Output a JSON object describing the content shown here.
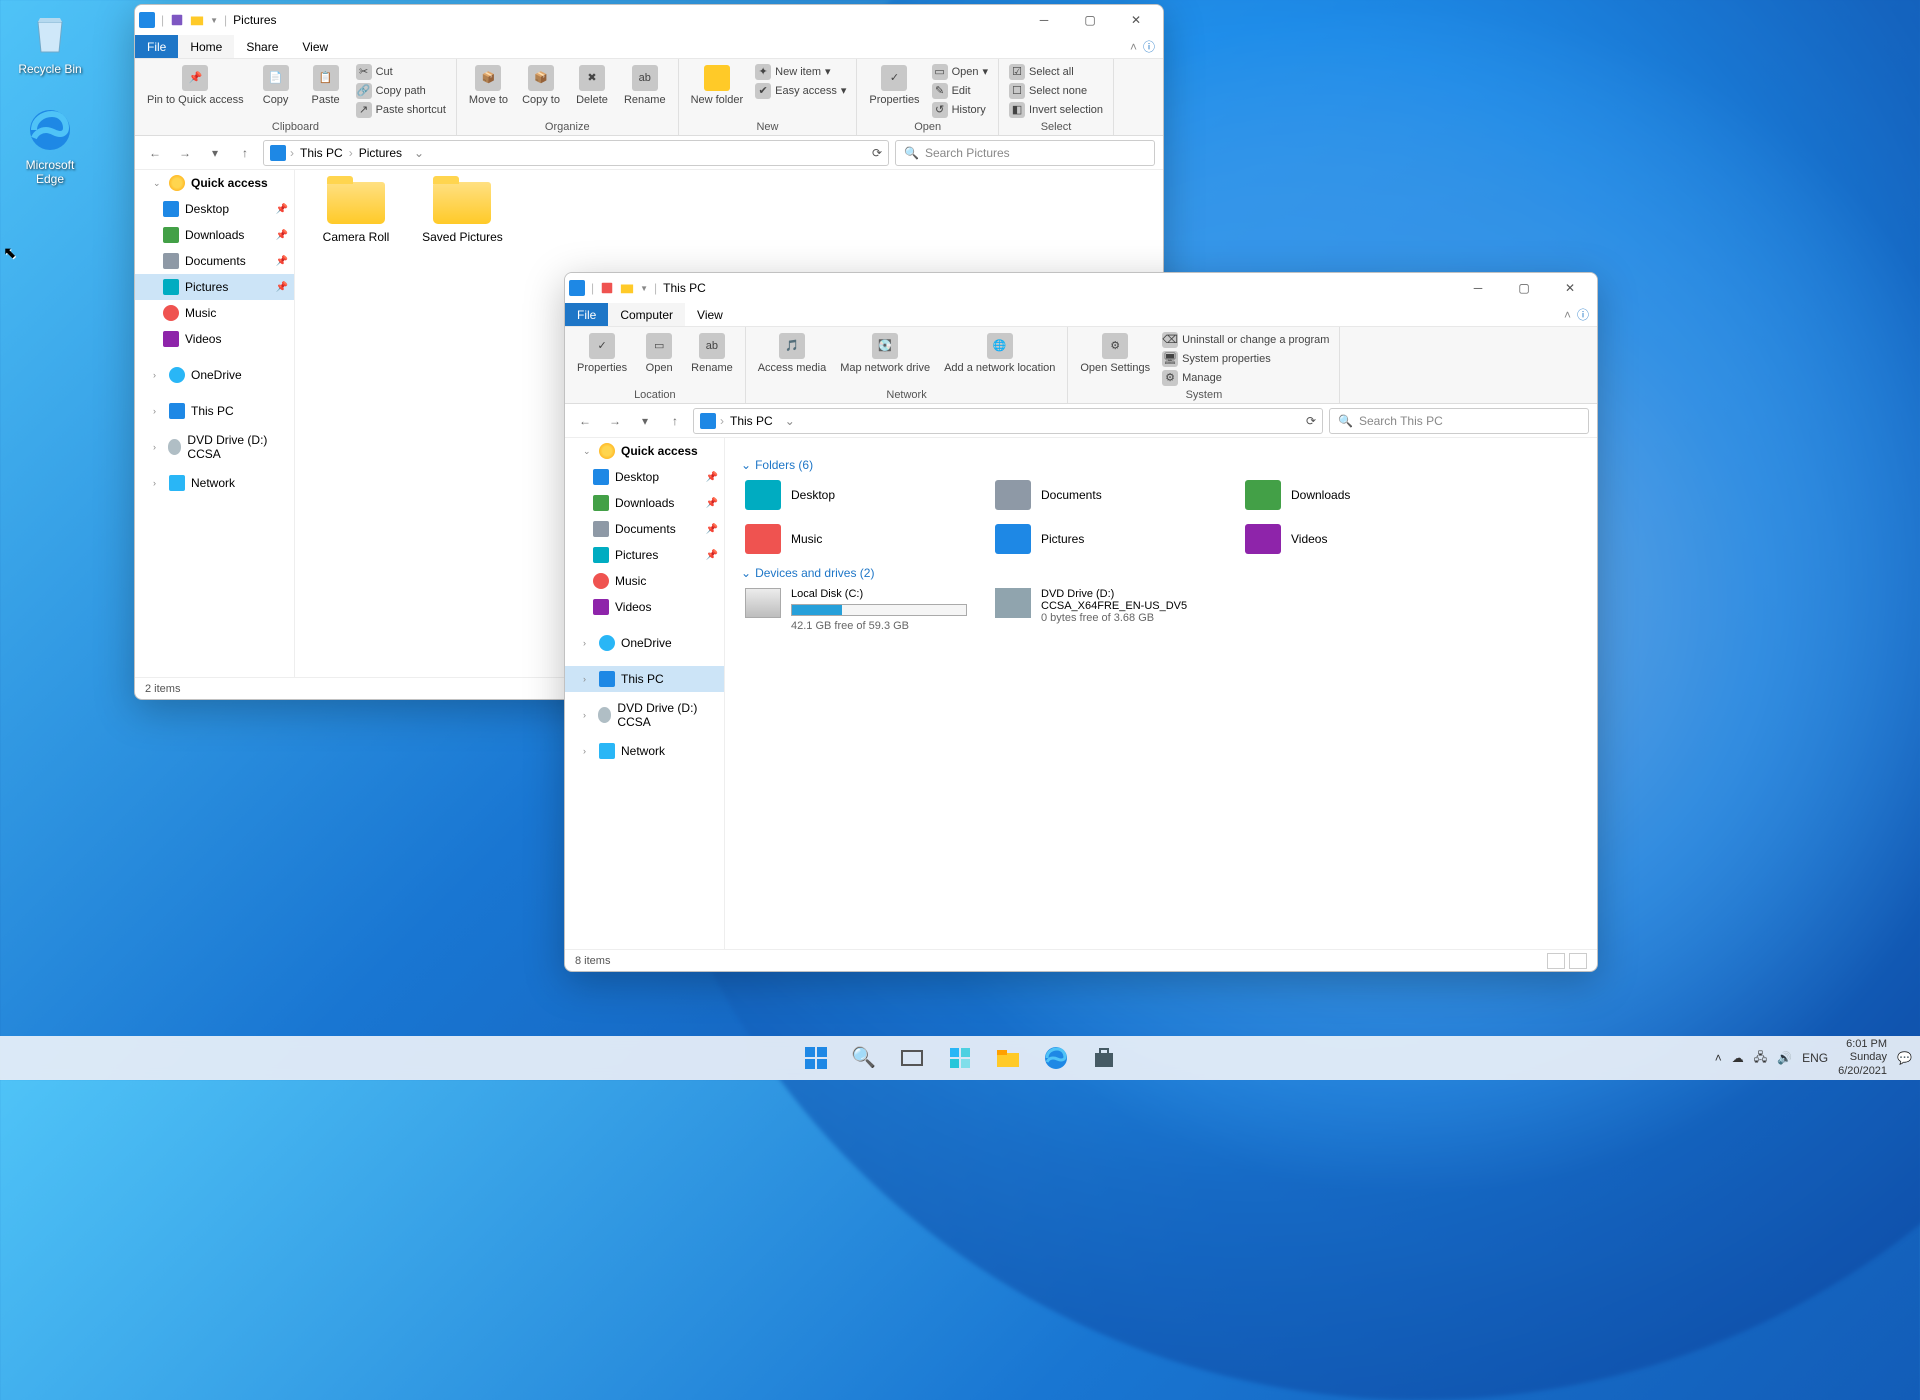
{
  "desktop": {
    "icons": [
      {
        "name": "recycle-bin",
        "label": "Recycle Bin"
      },
      {
        "name": "microsoft-edge",
        "label": "Microsoft Edge"
      }
    ]
  },
  "win1": {
    "title": "Pictures",
    "tabs": {
      "file": "File",
      "t": [
        "Home",
        "Share",
        "View"
      ]
    },
    "ribbon": {
      "clipboard": {
        "pin": "Pin to Quick\naccess",
        "copy": "Copy",
        "paste": "Paste",
        "cut": "Cut",
        "copypath": "Copy path",
        "shortcut": "Paste shortcut",
        "label": "Clipboard"
      },
      "organize": {
        "move": "Move\nto",
        "copyto": "Copy\nto",
        "delete": "Delete",
        "rename": "Rename",
        "label": "Organize"
      },
      "new": {
        "folder": "New\nfolder",
        "item": "New item",
        "easy": "Easy access",
        "label": "New"
      },
      "open": {
        "props": "Properties",
        "open": "Open",
        "edit": "Edit",
        "history": "History",
        "label": "Open"
      },
      "select": {
        "all": "Select all",
        "none": "Select none",
        "invert": "Invert selection",
        "label": "Select"
      }
    },
    "breadcrumb": [
      "This PC",
      "Pictures"
    ],
    "search_ph": "Search Pictures",
    "nav": {
      "quickaccess": "Quick access",
      "items": [
        "Desktop",
        "Downloads",
        "Documents",
        "Pictures",
        "Music",
        "Videos"
      ],
      "onedrive": "OneDrive",
      "thispc": "This PC",
      "dvd": "DVD Drive (D:) CCSA",
      "network": "Network"
    },
    "content": {
      "folders": [
        "Camera Roll",
        "Saved Pictures"
      ]
    },
    "status": "2 items"
  },
  "win2": {
    "title": "This PC",
    "tabs": {
      "file": "File",
      "t": [
        "Computer",
        "View"
      ]
    },
    "ribbon": {
      "location": {
        "props": "Properties",
        "open": "Open",
        "rename": "Rename",
        "label": "Location"
      },
      "network": {
        "access": "Access\nmedia",
        "map": "Map network\ndrive",
        "add": "Add a network\nlocation",
        "label": "Network"
      },
      "system": {
        "open": "Open\nSettings",
        "uninstall": "Uninstall or change a program",
        "sysprops": "System properties",
        "manage": "Manage",
        "label": "System"
      }
    },
    "breadcrumb": [
      "This PC"
    ],
    "search_ph": "Search This PC",
    "nav": {
      "quickaccess": "Quick access",
      "items": [
        "Desktop",
        "Downloads",
        "Documents",
        "Pictures",
        "Music",
        "Videos"
      ],
      "onedrive": "OneDrive",
      "thispc": "This PC",
      "dvd": "DVD Drive (D:) CCSA",
      "network": "Network"
    },
    "content": {
      "folders_head": "Folders (6)",
      "folders": [
        "Desktop",
        "Documents",
        "Downloads",
        "Music",
        "Pictures",
        "Videos"
      ],
      "drives_head": "Devices and drives (2)",
      "c": {
        "name": "Local Disk (C:)",
        "free": "42.1 GB free of 59.3 GB",
        "fill_pct": 29
      },
      "d": {
        "name": "DVD Drive (D:)",
        "name2": "CCSA_X64FRE_EN-US_DV5",
        "free": "0 bytes free of 3.68 GB"
      }
    },
    "status": "8 items"
  },
  "taskbar": {
    "lang": "ENG",
    "time": "6:01 PM",
    "day": "Sunday",
    "date": "6/20/2021"
  }
}
